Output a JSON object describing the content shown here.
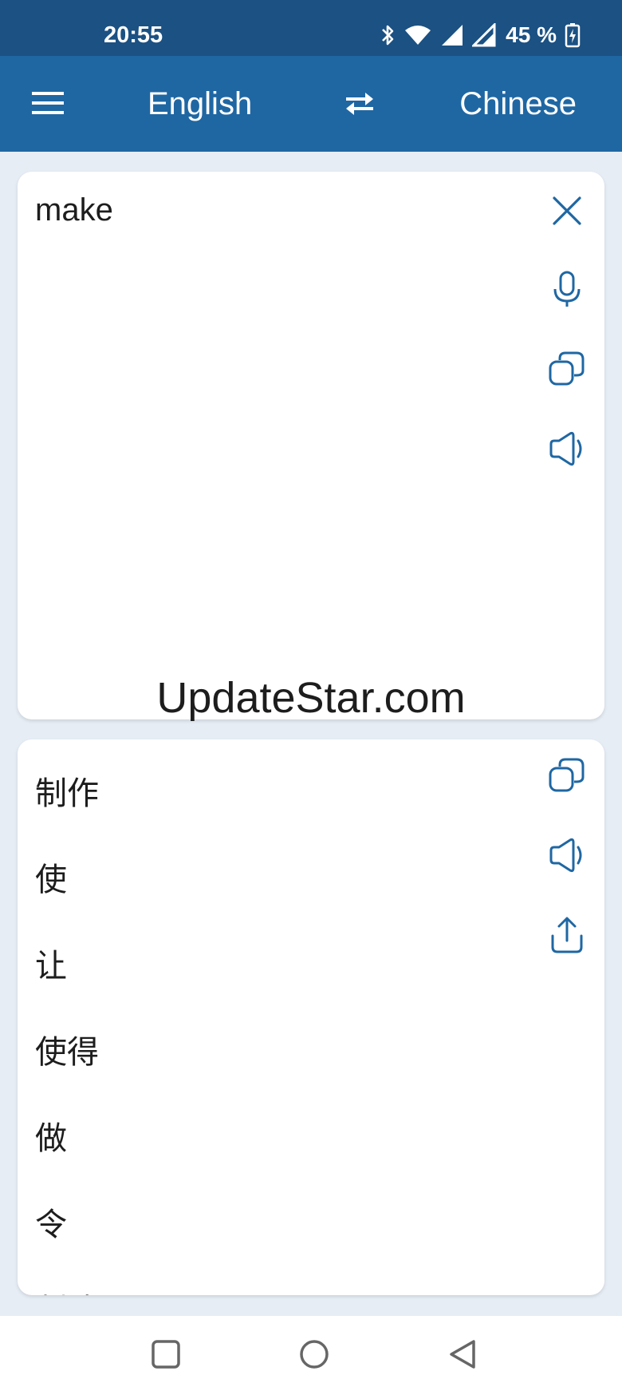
{
  "status_bar": {
    "time": "20:55",
    "battery": "45 %",
    "icons": [
      "bluetooth-icon",
      "wifi-icon",
      "signal-icon",
      "signal-icon",
      "battery-charging-icon"
    ]
  },
  "app_bar": {
    "menu_icon": "hamburger-menu-icon",
    "source_language": "English",
    "swap_icon": "swap-arrows-icon",
    "target_language": "Chinese",
    "background": "#1f67a3"
  },
  "input": {
    "text": "make",
    "actions": [
      "close-icon",
      "microphone-icon",
      "copy-icon",
      "speaker-icon"
    ]
  },
  "watermark": "UpdateStar.com",
  "output": {
    "translations": [
      "制作",
      "使",
      "让",
      "使得",
      "做",
      "令",
      "制造"
    ],
    "actions": [
      "copy-icon",
      "speaker-icon",
      "share-icon"
    ]
  },
  "nav_bar": {
    "buttons": [
      "recent-apps-icon",
      "home-icon",
      "back-icon"
    ]
  },
  "colors": {
    "status_bar": "#1b5183",
    "accent_icon": "#1f67a3",
    "page_background": "#e6edf5"
  }
}
